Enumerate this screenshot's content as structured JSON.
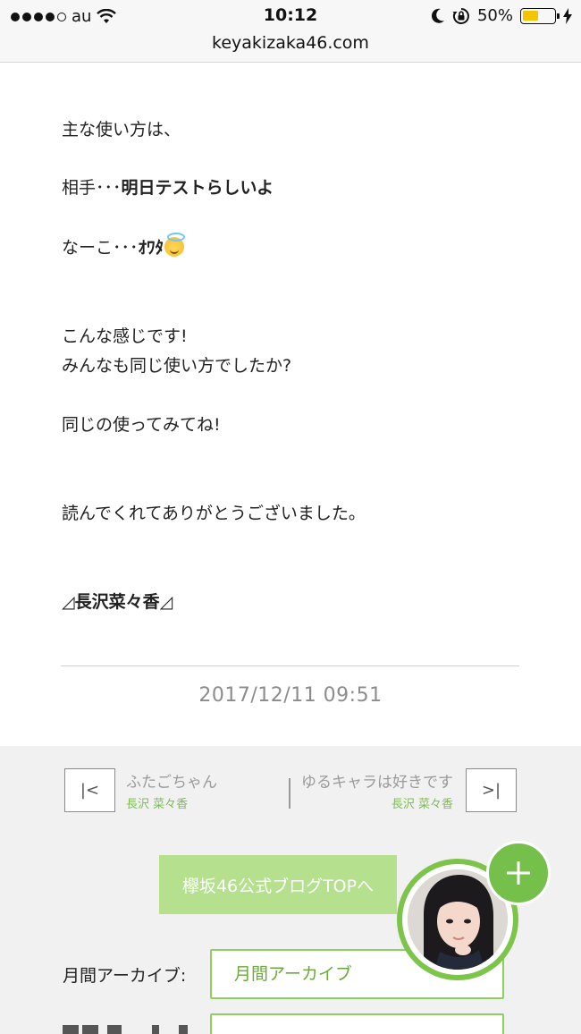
{
  "status_bar": {
    "carrier": "au",
    "time": "10:12",
    "battery_percent": "50%",
    "battery_level": 0.5
  },
  "browser": {
    "url": "keyakizaka46.com"
  },
  "post": {
    "line1": "主な使い方は、",
    "line2_prefix": "相手･･･",
    "line2_bold": "明日テストらしいよ",
    "line3_prefix": "なーこ･･･",
    "line3_bold": "ｵﾜﾀ",
    "line4": "こんな感じです!",
    "line5": "みんなも同じ使い方でしたか?",
    "line6": "同じの使ってみてね!",
    "line7": "読んでくれてありがとうございました。",
    "signature": "◿長沢菜々香◿",
    "date": "2017/12/11 09:51"
  },
  "navigation": {
    "prev": {
      "icon_label": "|<",
      "title": "ふたごちゃん",
      "author": "長沢 菜々香"
    },
    "next": {
      "icon_label": ">|",
      "title": "ゆるキャラは好きです",
      "author": "長沢 菜々香"
    }
  },
  "blog_top_button": "欅坂46公式ブログTOPへ",
  "archive": {
    "label": "月間アーカイブ:",
    "select_value": "月間アーカイブ"
  },
  "colors": {
    "accent_green": "#7cc44a",
    "button_green": "#b5e08e",
    "author_green": "#7cbf52"
  },
  "icons": {
    "wifi": "wifi-icon",
    "moon": "moon-icon",
    "rotation_lock": "rotation-lock-icon",
    "charging": "charging-bolt-icon",
    "plus": "plus-icon",
    "emoji": "smiling-face-with-halo-icon"
  }
}
